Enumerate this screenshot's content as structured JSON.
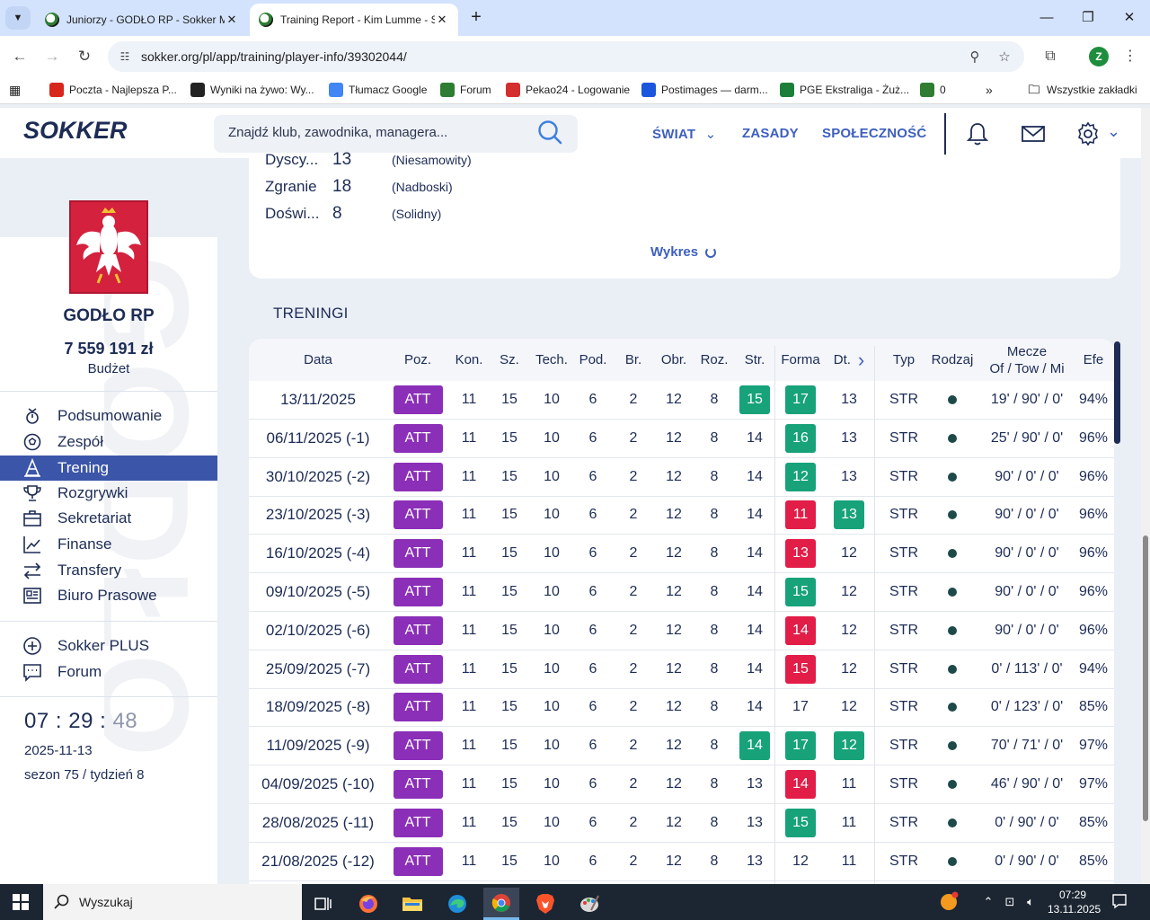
{
  "browser": {
    "tabs": [
      {
        "title": "Juniorzy - GODŁO RP - Sokker Manager",
        "active": false
      },
      {
        "title": "Training Report - Kim Lumme - Sokker Manager",
        "active": true
      }
    ],
    "url": "sokker.org/pl/app/training/player-info/39302044/",
    "profile_initial": "Z",
    "bookmarks": [
      {
        "label": "Poczta - Najlepsza P...",
        "icon": "wp-icon",
        "color": "#d9261c"
      },
      {
        "label": "Wyniki na żywo: Wy...",
        "icon": "scoreboard-icon",
        "color": "#222222"
      },
      {
        "label": "Tłumacz Google",
        "icon": "translate-icon",
        "color": "#4285f4"
      },
      {
        "label": "Forum",
        "icon": "football-icon",
        "color": "#2e7d32"
      },
      {
        "label": "Pekao24 - Logowanie",
        "icon": "bank-icon",
        "color": "#d32f2f"
      },
      {
        "label": "Postimages — darm...",
        "icon": "postimages-icon",
        "color": "#1a56db"
      },
      {
        "label": "PGE Ekstraliga - Żuż...",
        "icon": "ekstraliga-icon",
        "color": "#1b7f3a"
      },
      {
        "label": "0",
        "icon": "football-icon",
        "color": "#2e7d32"
      }
    ],
    "all_bookmarks": "Wszystkie zakładki"
  },
  "header": {
    "logo": "SOKKER",
    "search_placeholder": "Znajdź klub, zawodnika, managera...",
    "nav": [
      "ŚWIAT",
      "ZASADY",
      "SPOŁECZNOŚĆ"
    ]
  },
  "sidebar": {
    "watermark": "GODŁO",
    "club_name": "GODŁO RP",
    "budget_value": "7 559 191 zł",
    "budget_label": "Budżet",
    "menu": [
      {
        "label": "Podsumowanie",
        "icon": "summary-icon",
        "active": false
      },
      {
        "label": "Zespół",
        "icon": "ball-icon",
        "active": false
      },
      {
        "label": "Trening",
        "icon": "training-cone-icon",
        "active": true
      },
      {
        "label": "Rozgrywki",
        "icon": "trophy-icon",
        "active": false
      },
      {
        "label": "Sekretariat",
        "icon": "briefcase-icon",
        "active": false
      },
      {
        "label": "Finanse",
        "icon": "chart-line-icon",
        "active": false
      },
      {
        "label": "Transfery",
        "icon": "transfer-arrows-icon",
        "active": false
      },
      {
        "label": "Biuro Prasowe",
        "icon": "newspaper-icon",
        "active": false
      }
    ],
    "extra_menu": [
      {
        "label": "Sokker PLUS",
        "icon": "plus-circle-icon"
      },
      {
        "label": "Forum",
        "icon": "chat-icon"
      }
    ],
    "clock": {
      "hh": "07",
      "mm": "29",
      "ss": "48"
    },
    "date": "2025-11-13",
    "season": "sezon 75 / tydzień 8"
  },
  "stats": [
    {
      "name": "Dyscy...",
      "value": "13",
      "desc": "(Niesamowity)"
    },
    {
      "name": "Zgranie",
      "value": "18",
      "desc": "(Nadboski)"
    },
    {
      "name": "Doświ...",
      "value": "8",
      "desc": "(Solidny)"
    }
  ],
  "chart_link": "Wykres",
  "section_title": "TRENINGI",
  "table": {
    "columns": [
      "Data",
      "Poz.",
      "Kon.",
      "Sz.",
      "Tech.",
      "Pod.",
      "Br.",
      "Obr.",
      "Roz.",
      "Str.",
      "Forma",
      "Dt.",
      "Typ",
      "Rodzaj",
      "Mecze",
      "Efe"
    ],
    "mecze_sub": "Of / Tow / Mi",
    "colors": {
      "green": "#17a27a",
      "red": "#e11d48",
      "purple": "#8b2fb8"
    },
    "rows": [
      {
        "date": "13/11/2025",
        "pos": "ATT",
        "kon": "11",
        "sz": "15",
        "tech": "10",
        "pod": "6",
        "br": "2",
        "obr": "12",
        "roz": "8",
        "str": "15",
        "str_badge": "green",
        "forma": "17",
        "forma_badge": "green",
        "dt": "13",
        "dt_badge": "",
        "typ": "STR",
        "mecze": "19' / 90' / 0'",
        "efe": "94%"
      },
      {
        "date": "06/11/2025 (-1)",
        "pos": "ATT",
        "kon": "11",
        "sz": "15",
        "tech": "10",
        "pod": "6",
        "br": "2",
        "obr": "12",
        "roz": "8",
        "str": "14",
        "str_badge": "",
        "forma": "16",
        "forma_badge": "green",
        "dt": "13",
        "dt_badge": "",
        "typ": "STR",
        "mecze": "25' / 90' / 0'",
        "efe": "96%"
      },
      {
        "date": "30/10/2025 (-2)",
        "pos": "ATT",
        "kon": "11",
        "sz": "15",
        "tech": "10",
        "pod": "6",
        "br": "2",
        "obr": "12",
        "roz": "8",
        "str": "14",
        "str_badge": "",
        "forma": "12",
        "forma_badge": "green",
        "dt": "13",
        "dt_badge": "",
        "typ": "STR",
        "mecze": "90' / 0' / 0'",
        "efe": "96%"
      },
      {
        "date": "23/10/2025 (-3)",
        "pos": "ATT",
        "kon": "11",
        "sz": "15",
        "tech": "10",
        "pod": "6",
        "br": "2",
        "obr": "12",
        "roz": "8",
        "str": "14",
        "str_badge": "",
        "forma": "11",
        "forma_badge": "red",
        "dt": "13",
        "dt_badge": "green",
        "typ": "STR",
        "mecze": "90' / 0' / 0'",
        "efe": "96%"
      },
      {
        "date": "16/10/2025 (-4)",
        "pos": "ATT",
        "kon": "11",
        "sz": "15",
        "tech": "10",
        "pod": "6",
        "br": "2",
        "obr": "12",
        "roz": "8",
        "str": "14",
        "str_badge": "",
        "forma": "13",
        "forma_badge": "red",
        "dt": "12",
        "dt_badge": "",
        "typ": "STR",
        "mecze": "90' / 0' / 0'",
        "efe": "96%"
      },
      {
        "date": "09/10/2025 (-5)",
        "pos": "ATT",
        "kon": "11",
        "sz": "15",
        "tech": "10",
        "pod": "6",
        "br": "2",
        "obr": "12",
        "roz": "8",
        "str": "14",
        "str_badge": "",
        "forma": "15",
        "forma_badge": "green",
        "dt": "12",
        "dt_badge": "",
        "typ": "STR",
        "mecze": "90' / 0' / 0'",
        "efe": "96%"
      },
      {
        "date": "02/10/2025 (-6)",
        "pos": "ATT",
        "kon": "11",
        "sz": "15",
        "tech": "10",
        "pod": "6",
        "br": "2",
        "obr": "12",
        "roz": "8",
        "str": "14",
        "str_badge": "",
        "forma": "14",
        "forma_badge": "red",
        "dt": "12",
        "dt_badge": "",
        "typ": "STR",
        "mecze": "90' / 0' / 0'",
        "efe": "96%"
      },
      {
        "date": "25/09/2025 (-7)",
        "pos": "ATT",
        "kon": "11",
        "sz": "15",
        "tech": "10",
        "pod": "6",
        "br": "2",
        "obr": "12",
        "roz": "8",
        "str": "14",
        "str_badge": "",
        "forma": "15",
        "forma_badge": "red",
        "dt": "12",
        "dt_badge": "",
        "typ": "STR",
        "mecze": "0' / 113' / 0'",
        "efe": "94%"
      },
      {
        "date": "18/09/2025 (-8)",
        "pos": "ATT",
        "kon": "11",
        "sz": "15",
        "tech": "10",
        "pod": "6",
        "br": "2",
        "obr": "12",
        "roz": "8",
        "str": "14",
        "str_badge": "",
        "forma": "17",
        "forma_badge": "",
        "dt": "12",
        "dt_badge": "",
        "typ": "STR",
        "mecze": "0' / 123' / 0'",
        "efe": "85%"
      },
      {
        "date": "11/09/2025 (-9)",
        "pos": "ATT",
        "kon": "11",
        "sz": "15",
        "tech": "10",
        "pod": "6",
        "br": "2",
        "obr": "12",
        "roz": "8",
        "str": "14",
        "str_badge": "green",
        "forma": "17",
        "forma_badge": "green",
        "dt": "12",
        "dt_badge": "green",
        "typ": "STR",
        "mecze": "70' / 71' / 0'",
        "efe": "97%"
      },
      {
        "date": "04/09/2025 (-10)",
        "pos": "ATT",
        "kon": "11",
        "sz": "15",
        "tech": "10",
        "pod": "6",
        "br": "2",
        "obr": "12",
        "roz": "8",
        "str": "13",
        "str_badge": "",
        "forma": "14",
        "forma_badge": "red",
        "dt": "11",
        "dt_badge": "",
        "typ": "STR",
        "mecze": "46' / 90' / 0'",
        "efe": "97%"
      },
      {
        "date": "28/08/2025 (-11)",
        "pos": "ATT",
        "kon": "11",
        "sz": "15",
        "tech": "10",
        "pod": "6",
        "br": "2",
        "obr": "12",
        "roz": "8",
        "str": "13",
        "str_badge": "",
        "forma": "15",
        "forma_badge": "green",
        "dt": "11",
        "dt_badge": "",
        "typ": "STR",
        "mecze": "0' / 90' / 0'",
        "efe": "85%"
      },
      {
        "date": "21/08/2025 (-12)",
        "pos": "ATT",
        "kon": "11",
        "sz": "15",
        "tech": "10",
        "pod": "6",
        "br": "2",
        "obr": "12",
        "roz": "8",
        "str": "13",
        "str_badge": "",
        "forma": "12",
        "forma_badge": "",
        "dt": "11",
        "dt_badge": "",
        "typ": "STR",
        "mecze": "0' / 90' / 0'",
        "efe": "85%"
      }
    ]
  },
  "taskbar": {
    "search_label": "Wyszukaj",
    "time": "07:29",
    "date": "13.11.2025"
  }
}
